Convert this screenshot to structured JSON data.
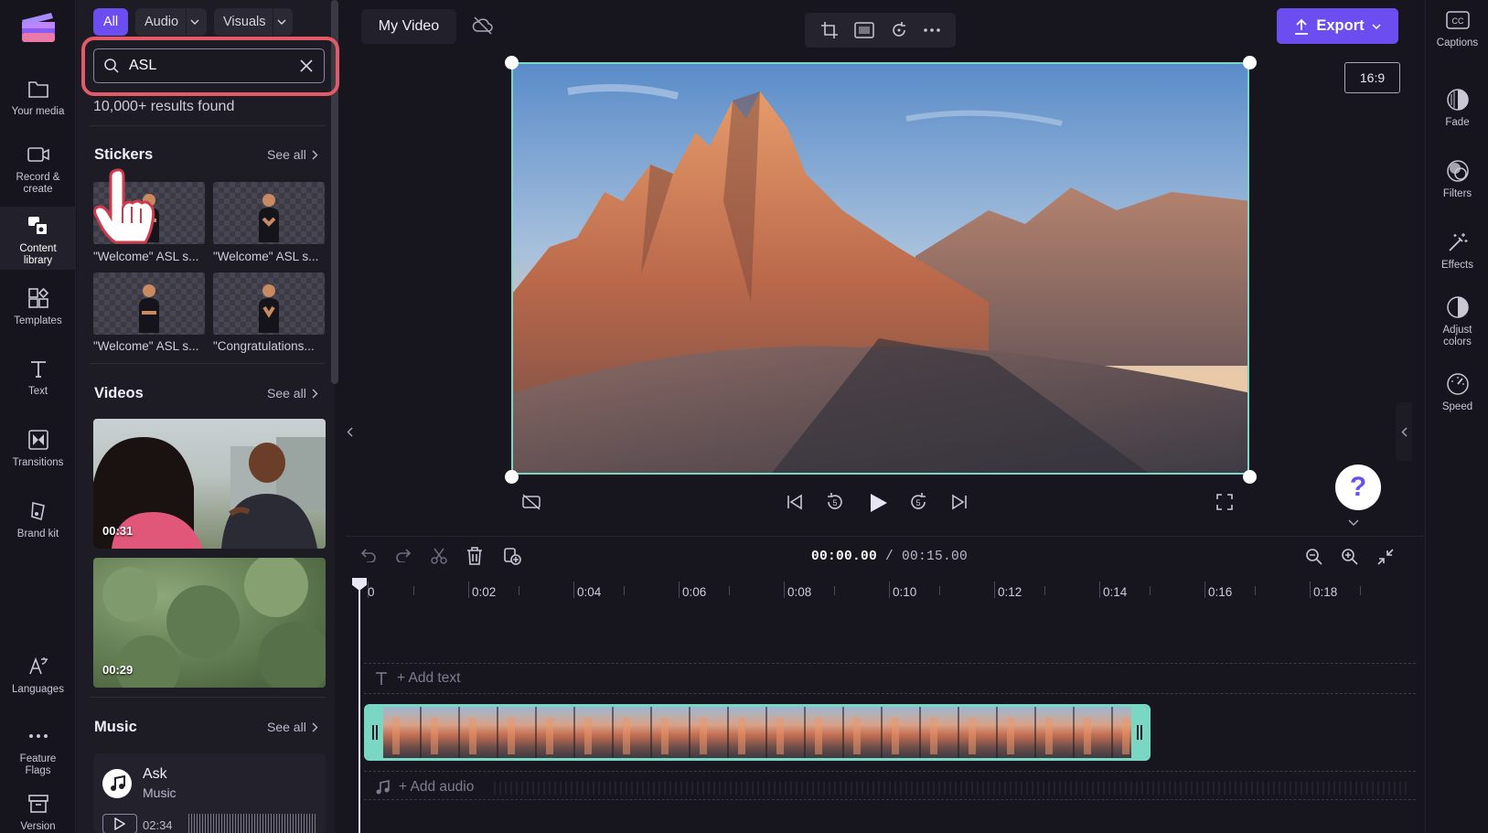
{
  "left_rail": {
    "items": [
      {
        "label": "Your media",
        "icon": "folder-icon"
      },
      {
        "label": "Record & create",
        "icon": "camera-icon"
      },
      {
        "label": "Content library",
        "icon": "library-icon"
      },
      {
        "label": "Templates",
        "icon": "templates-icon"
      },
      {
        "label": "Text",
        "icon": "text-icon"
      },
      {
        "label": "Transitions",
        "icon": "transitions-icon"
      },
      {
        "label": "Brand kit",
        "icon": "brand-kit-icon"
      },
      {
        "label": "Languages",
        "icon": "languages-icon"
      },
      {
        "label": "Feature Flags",
        "icon": "more-icon"
      },
      {
        "label": "Version",
        "icon": "archive-icon"
      }
    ]
  },
  "filters": {
    "all": "All",
    "audio": "Audio",
    "visuals": "Visuals"
  },
  "search": {
    "value": "ASL",
    "results": "10,000+ results found"
  },
  "stickers": {
    "title": "Stickers",
    "see_all": "See all",
    "items": [
      "\"Welcome\" ASL s...",
      "\"Welcome\" ASL s...",
      "\"Welcome\" ASL s...",
      "\"Congratulations..."
    ]
  },
  "videos": {
    "title": "Videos",
    "see_all": "See all",
    "items": [
      {
        "duration": "00:31"
      },
      {
        "duration": "00:29"
      }
    ]
  },
  "music": {
    "title": "Music",
    "see_all": "See all",
    "track": {
      "title": "Ask",
      "subtitle": "Music",
      "duration": "02:34"
    }
  },
  "header": {
    "project_title": "My Video",
    "export_label": "Export",
    "aspect_ratio": "16:9"
  },
  "right_rail": {
    "items": [
      {
        "label": "Captions",
        "icon": "captions-icon"
      },
      {
        "label": "Fade",
        "icon": "fade-icon"
      },
      {
        "label": "Filters",
        "icon": "filters-icon"
      },
      {
        "label": "Effects",
        "icon": "effects-icon"
      },
      {
        "label": "Adjust colors",
        "icon": "adjust-colors-icon"
      },
      {
        "label": "Speed",
        "icon": "speed-icon"
      }
    ]
  },
  "timeline": {
    "current_time": "00:00.00",
    "separator": " / ",
    "total_time": "00:15.00",
    "ticks": [
      "0",
      "0:02",
      "0:04",
      "0:06",
      "0:08",
      "0:10",
      "0:12",
      "0:14",
      "0:16",
      "0:18"
    ],
    "add_text": "+ Add text",
    "add_audio": "+ Add audio"
  },
  "help": {
    "label": "?"
  },
  "colors": {
    "accent": "#6b4df0",
    "selection": "#7ad7c4",
    "highlight": "#e55a69"
  }
}
